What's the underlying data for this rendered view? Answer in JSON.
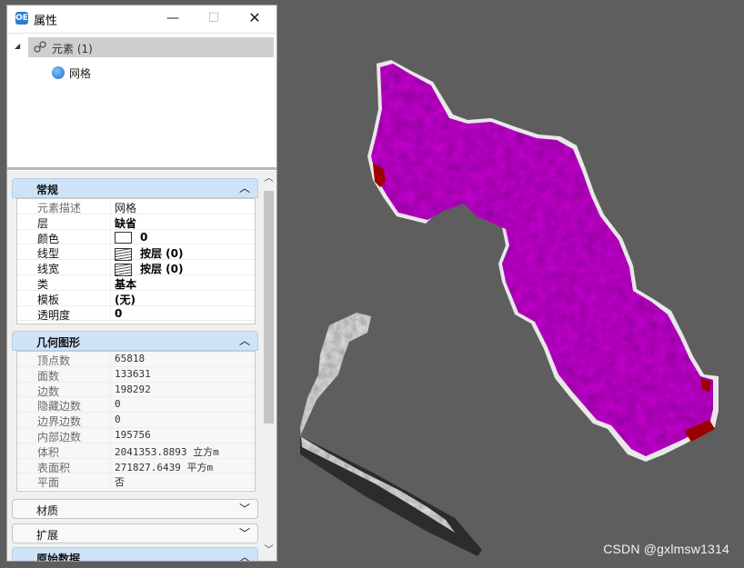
{
  "window": {
    "title": "属性",
    "icon_text": "OE",
    "minimize": "—",
    "maximize": "☐",
    "close": "✕"
  },
  "tree": {
    "root_label": "元素 (1)",
    "child_label": "网格"
  },
  "sections": {
    "general": {
      "title": "常规",
      "rows": [
        {
          "key": "元素描述",
          "value": "网格"
        },
        {
          "key": "层",
          "value": "缺省"
        },
        {
          "key": "颜色",
          "value": "0"
        },
        {
          "key": "线型",
          "value": "按层 (0)"
        },
        {
          "key": "线宽",
          "value": "按层 (0)"
        },
        {
          "key": "类",
          "value": "基本"
        },
        {
          "key": "模板",
          "value": "(无)"
        },
        {
          "key": "透明度",
          "value": "0"
        }
      ]
    },
    "geometry": {
      "title": "几何图形",
      "rows": [
        {
          "key": "顶点数",
          "value": "65818"
        },
        {
          "key": "面数",
          "value": "133631"
        },
        {
          "key": "边数",
          "value": "198292"
        },
        {
          "key": "隐藏边数",
          "value": "0"
        },
        {
          "key": "边界边数",
          "value": "0"
        },
        {
          "key": "内部边数",
          "value": "195756"
        },
        {
          "key": "体积",
          "value": "2041353.8893 立方m"
        },
        {
          "key": "表面积",
          "value": "271827.6439 平方m"
        },
        {
          "key": "平面",
          "value": "否"
        }
      ]
    },
    "material": {
      "title": "材质"
    },
    "extension": {
      "title": "扩展"
    },
    "raw": {
      "title": "原始数据"
    }
  },
  "watermark": "CSDN @gxlmsw1314",
  "colors": {
    "viewport_bg": "#5e5e5e",
    "terrain_magenta": "#c800d4",
    "terrain_red": "#9c0000",
    "terrain_white": "#e4e4e4",
    "section_header_bg": "#cfe3f7"
  },
  "icons": {
    "expand": "chevron-up-icon",
    "collapse": "chevron-down-icon"
  }
}
